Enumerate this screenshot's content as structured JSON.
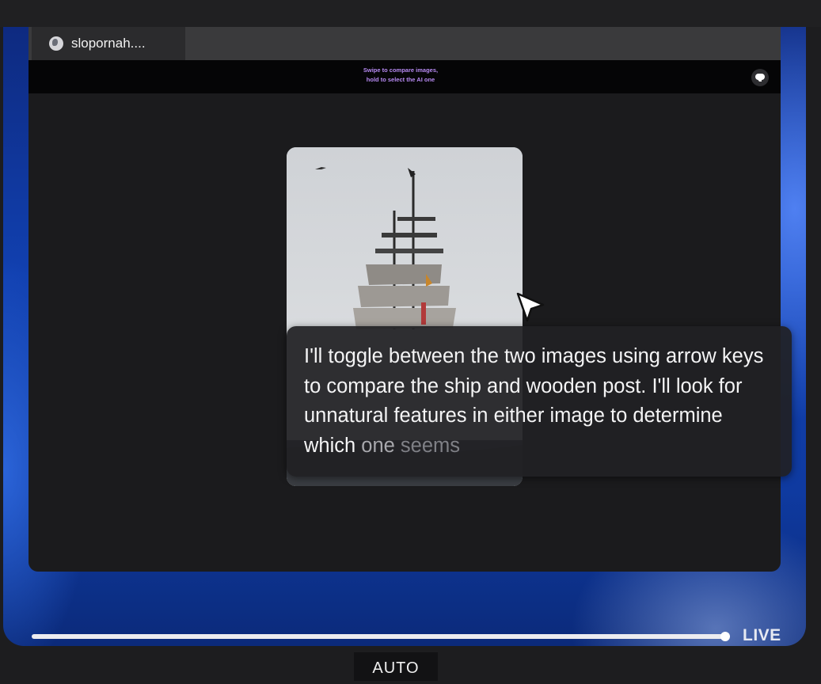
{
  "browser": {
    "tab_title": "slopornah...."
  },
  "banner": {
    "line1": "Swipe to compare images,",
    "line2": "hold to select the AI one"
  },
  "tooltip": {
    "text_main": "I'll toggle between the two images using arrow keys to compare the ship and wooden post. I'll look for unnatural features in either image to determine which ",
    "text_fade1": "one ",
    "text_fade2": "seems"
  },
  "player": {
    "live_label": "LIVE",
    "progress_fraction": 1.0
  },
  "quality": {
    "label": "AUTO"
  },
  "colors": {
    "banner_text": "#b78af2",
    "frame_accent": "#1140b0"
  },
  "icons": [
    "globe-icon",
    "chat-bubble-icon",
    "cursor-arrow-icon"
  ]
}
